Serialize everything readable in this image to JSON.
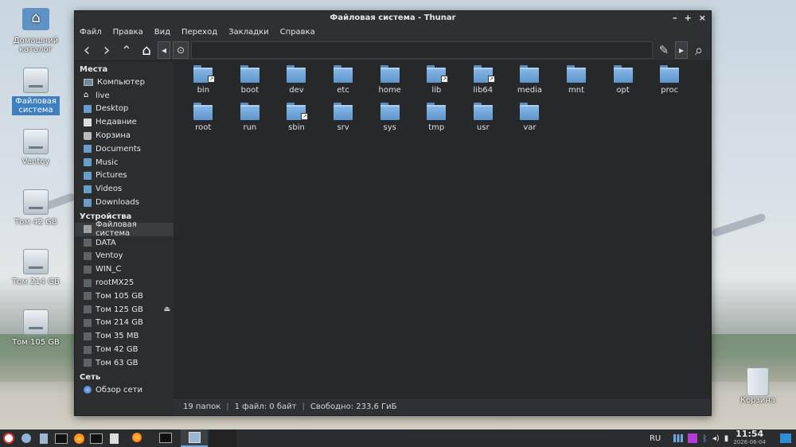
{
  "desktop": {
    "icons": [
      {
        "label": "Домашний каталог"
      },
      {
        "label": "Файловая система"
      },
      {
        "label": "Ventoy"
      },
      {
        "label": "Том 42 GB"
      },
      {
        "label": "Том 214 GB"
      },
      {
        "label": "Том 105 GB"
      },
      {
        "label": "Корзина"
      }
    ]
  },
  "window": {
    "title": "Файловая система - Thunar",
    "controls": {
      "minimize": "–",
      "maximize": "+",
      "close": "×"
    }
  },
  "menu": [
    "Файл",
    "Правка",
    "Вид",
    "Переход",
    "Закладки",
    "Справка"
  ],
  "toolbar": {
    "back_icon": "‹",
    "forward_icon": "›",
    "up_icon": "⌃",
    "home_icon": "⌂",
    "path_left_icon": "◂",
    "root_label": "⊙",
    "edit_icon": "✎",
    "path_right_icon": "▸",
    "search_icon": "⌕"
  },
  "sidebar": {
    "places_title": "Места",
    "places": [
      {
        "label": "Компьютер",
        "icon": "monitor"
      },
      {
        "label": "live",
        "icon": "home"
      },
      {
        "label": "Desktop",
        "icon": "folder"
      },
      {
        "label": "Недавние",
        "icon": "recent"
      },
      {
        "label": "Корзина",
        "icon": "trash"
      },
      {
        "label": "Documents",
        "icon": "folder"
      },
      {
        "label": "Music",
        "icon": "folder"
      },
      {
        "label": "Pictures",
        "icon": "folder"
      },
      {
        "label": "Videos",
        "icon": "folder"
      },
      {
        "label": "Downloads",
        "icon": "folder"
      }
    ],
    "devices_title": "Устройства",
    "devices": [
      {
        "label": "Файловая система",
        "active": true
      },
      {
        "label": "DATA"
      },
      {
        "label": "Ventoy"
      },
      {
        "label": "WIN_C"
      },
      {
        "label": "rootMX25"
      },
      {
        "label": "Том 105 GB"
      },
      {
        "label": "Том 125 GB",
        "eject": "⏏"
      },
      {
        "label": "Том 214 GB"
      },
      {
        "label": "Том 35 MB"
      },
      {
        "label": "Том 42 GB"
      },
      {
        "label": "Том 63 GB"
      }
    ],
    "network_title": "Сеть",
    "network": [
      {
        "label": "Обзор сети"
      }
    ]
  },
  "files": [
    {
      "name": "bin",
      "link": true
    },
    {
      "name": "boot"
    },
    {
      "name": "dev"
    },
    {
      "name": "etc"
    },
    {
      "name": "home"
    },
    {
      "name": "lib",
      "link": true
    },
    {
      "name": "lib64",
      "link": true
    },
    {
      "name": "media"
    },
    {
      "name": "mnt"
    },
    {
      "name": "opt"
    },
    {
      "name": "proc"
    },
    {
      "name": "root"
    },
    {
      "name": "run"
    },
    {
      "name": "sbin",
      "link": true
    },
    {
      "name": "srv"
    },
    {
      "name": "sys"
    },
    {
      "name": "tmp"
    },
    {
      "name": "usr"
    },
    {
      "name": "var"
    }
  ],
  "status": {
    "folders": "19 папок",
    "files": "1 файл: 0 байт",
    "free": "Свободно: 233,6 ГиБ"
  },
  "taskbar": {
    "lang": "RU",
    "time": "11:54",
    "date": "2026-06-04"
  }
}
